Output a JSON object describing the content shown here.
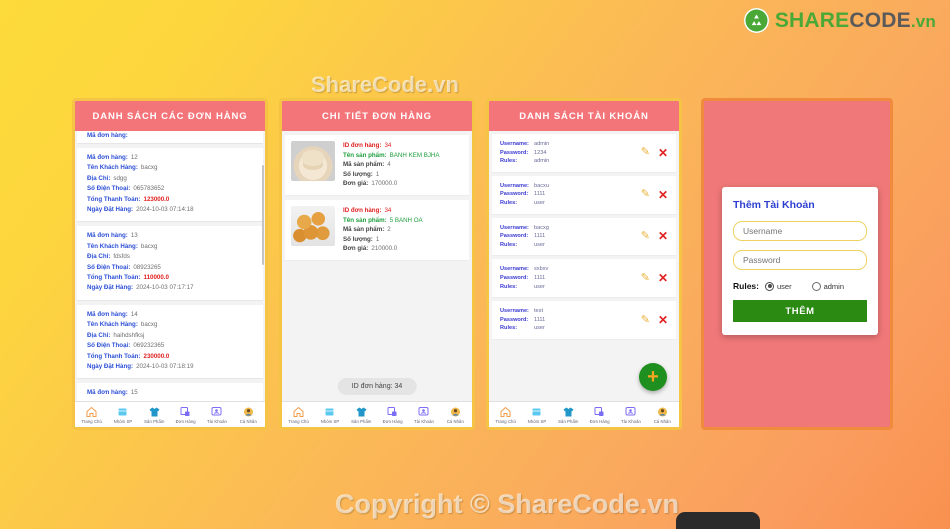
{
  "brand": {
    "logo_share": "SHARE",
    "logo_code": "CODE",
    "logo_vn": ".vn",
    "watermark_top": "ShareCode.vn",
    "watermark_bottom": "Copyright © ShareCode.vn"
  },
  "colors": {
    "appbar": "#f3757a",
    "label_blue": "#2d4fd6",
    "amount_red": "#e02020",
    "product_green": "#1e9e3e",
    "fab_green": "#1f8f1f",
    "button_green": "#2a8a12",
    "input_border": "#f0d264",
    "phone_border": "#f6c445"
  },
  "nav": {
    "items": [
      {
        "label": "Trang Chủ",
        "icon": "home-icon"
      },
      {
        "label": "Nhóm SP",
        "icon": "box-icon"
      },
      {
        "label": "Sản Phẩm",
        "icon": "shirt-icon"
      },
      {
        "label": "Đơn Hàng",
        "icon": "order-icon"
      },
      {
        "label": "Tài Khoản",
        "icon": "account-icon"
      },
      {
        "label": "Cá Nhân",
        "icon": "person-icon"
      }
    ]
  },
  "phone1": {
    "title": "DANH SÁCH CÁC ĐƠN HÀNG",
    "labels": {
      "order_id": "Mã đơn hàng:",
      "customer": "Tên Khách Hàng:",
      "address": "Địa Chỉ:",
      "phone": "Số Điện Thoại:",
      "total": "Tổng Thanh Toán:",
      "date": "Ngày Đặt Hàng:"
    },
    "orders": [
      {
        "order_id": "12",
        "customer": "bacxg",
        "address": "sdgg",
        "phone": "065783652",
        "total": "123000.0",
        "date": "2024-10-03 07:14:18"
      },
      {
        "order_id": "13",
        "customer": "bacxg",
        "address": "fdsfds",
        "phone": "08923265",
        "total": "110000.0",
        "date": "2024-10-03 07:17:17"
      },
      {
        "order_id": "14",
        "customer": "bacxg",
        "address": "haihdshfksj",
        "phone": "069232365",
        "total": "230000.0",
        "date": "2024-10-03 07:18:19"
      }
    ],
    "partial_next_order_id": "15"
  },
  "phone2": {
    "title": "CHI TIẾT ĐƠN HÀNG",
    "labels": {
      "order_id": "ID đơn hàng:",
      "product_name": "Tên sản phẩm:",
      "product_id": "Mã sản phẩm:",
      "quantity": "Số lượng:",
      "unit_price": "Đơn giá:"
    },
    "items": [
      {
        "order_id": "34",
        "product_name": "BANH KEM BJHA",
        "product_id": "4",
        "quantity": "1",
        "unit_price": "170000.0",
        "thumb": "cake"
      },
      {
        "order_id": "34",
        "product_name": "5 BANH OA",
        "product_id": "2",
        "quantity": "1",
        "unit_price": "210000.0",
        "thumb": "fried"
      }
    ],
    "toast": "ID đơn hàng: 34"
  },
  "phone3": {
    "title": "DANH SÁCH TÀI KHOẢN",
    "labels": {
      "username": "Username:",
      "password": "Password:",
      "rules": "Rules:"
    },
    "accounts": [
      {
        "username": "admin",
        "password": "1234",
        "rules": "admin"
      },
      {
        "username": "bacxu",
        "password": "1111",
        "rules": "user"
      },
      {
        "username": "bacxg",
        "password": "1111",
        "rules": "user"
      },
      {
        "username": "sxbxv",
        "password": "1111",
        "rules": "user"
      },
      {
        "username": "test",
        "password": "1111",
        "rules": "user"
      }
    ],
    "edit_icon": "pencil-icon",
    "delete_icon": "close-x-icon",
    "fab_icon": "plus-icon"
  },
  "phone4": {
    "dialog": {
      "title": "Thêm Tài Khoản",
      "username_placeholder": "Username",
      "username_value": "",
      "password_placeholder": "Password",
      "password_value": "",
      "rules_label": "Rules:",
      "option_user": "user",
      "option_admin": "admin",
      "selected_rule": "user",
      "submit_label": "THÊM"
    }
  }
}
